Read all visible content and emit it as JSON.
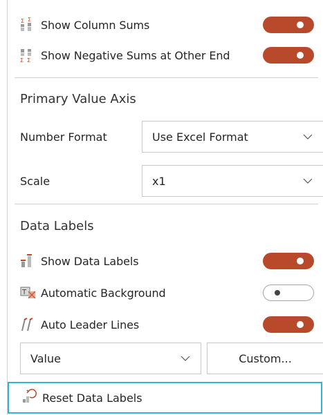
{
  "rows": {
    "show_column_sums": {
      "label": "Show Column Sums",
      "toggle": "on"
    },
    "show_negative_sums": {
      "label": "Show Negative Sums at Other End",
      "toggle": "on"
    },
    "show_data_labels": {
      "label": "Show Data Labels",
      "toggle": "on"
    },
    "automatic_background": {
      "label": "Automatic Background",
      "toggle": "off"
    },
    "auto_leader_lines": {
      "label": "Auto Leader Lines",
      "toggle": "on"
    }
  },
  "primary_value_axis": {
    "title": "Primary Value Axis",
    "number_format_label": "Number Format",
    "number_format_value": "Use Excel Format",
    "scale_label": "Scale",
    "scale_value": "x1"
  },
  "data_labels": {
    "title": "Data Labels",
    "label_select_value": "Value",
    "custom_button": "Custom...",
    "reset_label": "Reset Data Labels"
  },
  "colors": {
    "toggle_on": "#b84a2b",
    "focus_border": "#2fb2d8"
  }
}
